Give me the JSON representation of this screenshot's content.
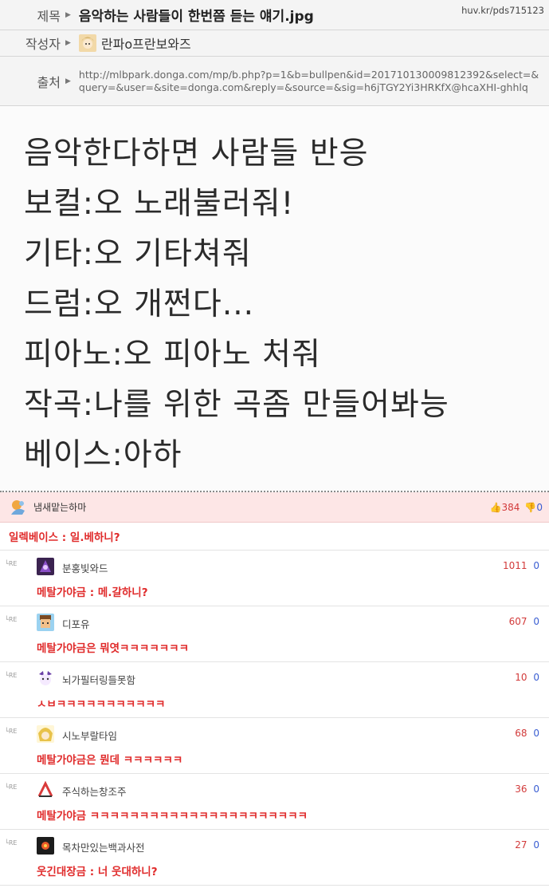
{
  "post": {
    "title_label": "제목",
    "title": "음악하는 사람들이 한번쯤 듣는 얘기.jpg",
    "url": "huv.kr/pds715123",
    "author_label": "작성자",
    "author": "란파ο프란보와즈",
    "source_label": "출처",
    "source": "http://mlbpark.donga.com/mp/b.php?p=1&b=bullpen&id=201710130009812392&select=&query=&user=&site=donga.com&reply=&source=&sig=h6jTGY2Yi3HRKfX@hcaXHI-ghhlq",
    "image_lines": [
      "음악한다하면 사람들 반응",
      "보컬:오 노래불러줘!",
      "기타:오 기타쳐줘",
      "드럼:오 개쩐다...",
      "피아노:오 피아노 처줘",
      "작곡:나를 위한 곡좀 만들어봐능",
      "베이스:아하"
    ]
  },
  "best_comment": {
    "nick": "냄새맡는하마",
    "likes": "384",
    "dislikes": "0",
    "text": "일렉베이스 : 일.베하니?"
  },
  "replies": [
    {
      "tag": "└RE",
      "nick": "분홍빛와드",
      "likes": "1011",
      "dislikes": "0",
      "text": "메탈가야금 : 메.갈하니?"
    },
    {
      "tag": "└RE",
      "nick": "디포유",
      "likes": "607",
      "dislikes": "0",
      "text": "메탈가야금은 뭐엿ㅋㅋㅋㅋㅋㅋㅋ"
    },
    {
      "tag": "└RE",
      "nick": "뇌가필터링들못함",
      "likes": "10",
      "dislikes": "0",
      "text": "ㅅㅂㅋㅋㅋㅋㅋㅋㅋㅋㅋㅋㅋ"
    },
    {
      "tag": "└RE",
      "nick": "시노부랄타임",
      "likes": "68",
      "dislikes": "0",
      "text": "메탈가야금은 뭔데 ㅋㅋㅋㅋㅋㅋ"
    },
    {
      "tag": "└RE",
      "nick": "주식하는창조주",
      "likes": "36",
      "dislikes": "0",
      "text": "메탈가야금 ㅋㅋㅋㅋㅋㅋㅋㅋㅋㅋㅋㅋㅋㅋㅋㅋㅋㅋㅋㅋㅋㅋ"
    },
    {
      "tag": "└RE",
      "nick": "목차만있는백과사전",
      "likes": "27",
      "dislikes": "0",
      "text": "웃긴대장금 : 너 웃대하니?"
    }
  ],
  "icons": {
    "arrow": "triangle-right-icon",
    "thumb_up": "thumb-up-icon",
    "thumb_down": "thumb-down-icon"
  },
  "colors": {
    "accent_red": "#e02b2b",
    "dislike_blue": "#3a5ed2",
    "best_bg": "#fde6e6"
  }
}
